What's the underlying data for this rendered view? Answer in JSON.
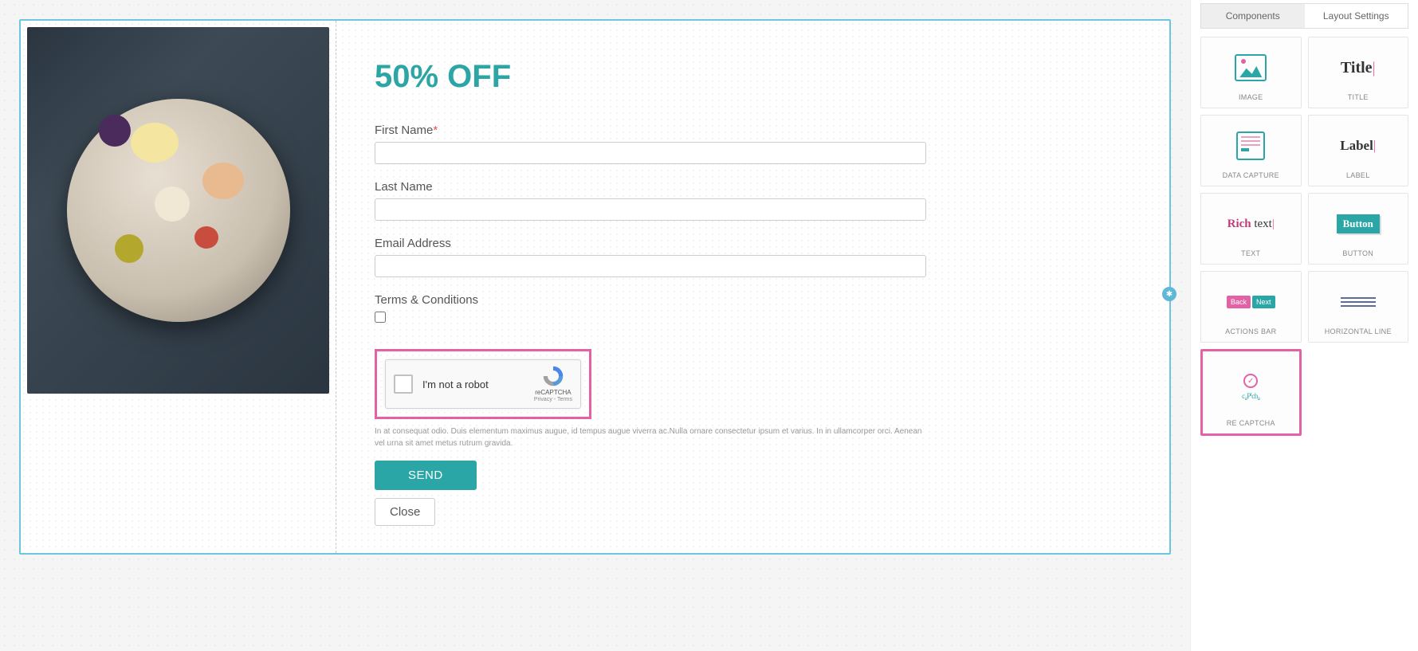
{
  "canvas": {
    "title": "50% OFF",
    "fields": {
      "first_name_label": "First Name",
      "last_name_label": "Last Name",
      "email_label": "Email Address",
      "terms_label": "Terms & Conditions"
    },
    "recaptcha": {
      "text": "I'm not a robot",
      "brand": "reCAPTCHA",
      "privacy": "Privacy",
      "terms": "Terms"
    },
    "lorem": "In at consequat odio. Duis elementum maximus augue, id tempus augue viverra ac.Nulla ornare consectetur ipsum et varius. In in ullamcorper orci. Aenean vel urna sit amet metus rutrum gravida.",
    "send_btn": "SEND",
    "close_btn": "Close"
  },
  "sidebar": {
    "tabs": {
      "components": "Components",
      "layout": "Layout Settings"
    },
    "components": {
      "image": "IMAGE",
      "title": "TITLE",
      "title_icon": "Title",
      "data_capture": "DATA CAPTURE",
      "label": "LABEL",
      "label_icon": "Label",
      "text": "TEXT",
      "richtext_bold": "Rich",
      "richtext_rest": " text",
      "button": "BUTTON",
      "button_icon": "Button",
      "actions_bar": "ACTIONS BAR",
      "ab_back": "Back",
      "ab_next": "Next",
      "hr": "HORIZONTAL LINE",
      "recaptcha": "RE CAPTCHA"
    }
  }
}
